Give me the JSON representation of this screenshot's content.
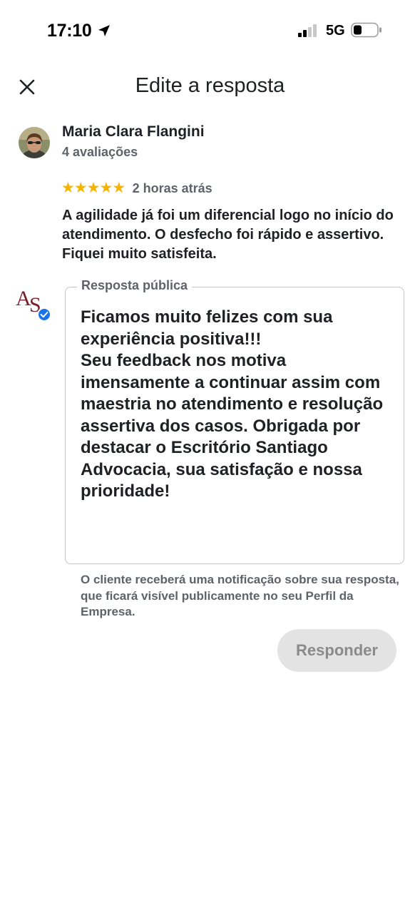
{
  "status_bar": {
    "time": "17:10",
    "network": "5G"
  },
  "header": {
    "title": "Edite a resposta",
    "close_icon": "close-icon"
  },
  "review": {
    "author": "Maria Clara Flangini",
    "author_reviews": "4 avaliações",
    "rating": 5,
    "stars": [
      "★",
      "★",
      "★",
      "★",
      "★"
    ],
    "time": "2 horas atrás",
    "text": "A agilidade já foi um diferencial logo no início do atendimento. O desfecho foi rápido e assertivo. Fiquei muito satisfeita."
  },
  "reply": {
    "label": "Resposta pública",
    "text": "Ficamos muito felizes com sua experiência positiva!!!\nSeu feedback nos motiva imensamente a continuar assim com maestria no atendimento e resolução assertiva dos casos. Obrigada por destacar o Escritório Santiago Advocacia, sua satisfação e nossa prioridade!"
  },
  "notice": "O cliente receberá uma notificação sobre sua resposta, que ficará visível publicamente no seu Perfil da Empresa.",
  "respond_button": "Responder",
  "colors": {
    "star": "#f4b400",
    "verified": "#1a73e8",
    "button_bg": "#e3e3e3",
    "logo": "#7a1f2b"
  }
}
